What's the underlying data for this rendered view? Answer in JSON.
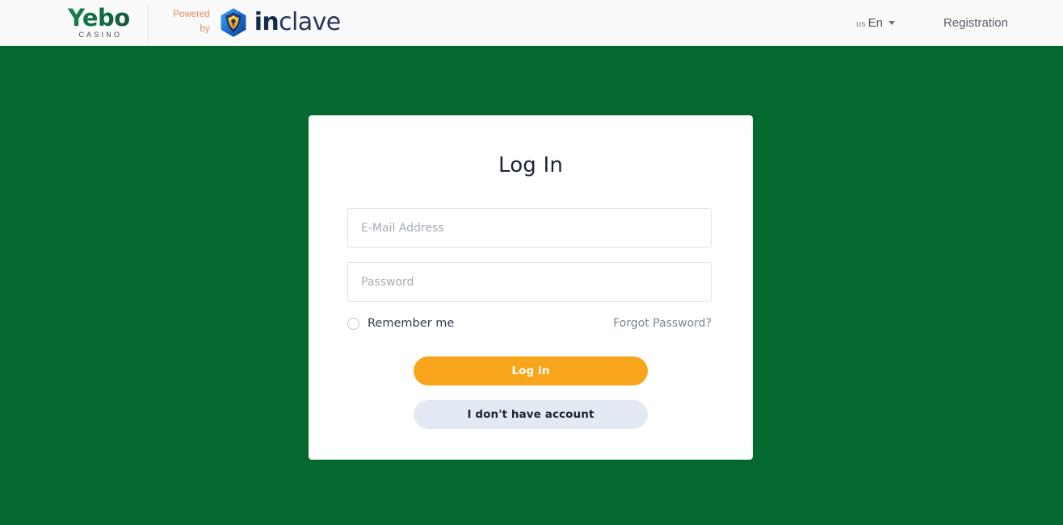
{
  "header": {
    "brand": {
      "name": "Yebo",
      "subtitle": "CASINO",
      "logo_color": "#15774A"
    },
    "powered": {
      "line1": "Powered",
      "line2": "by",
      "color": "#E48A62"
    },
    "partner": {
      "name_bold": "in",
      "name_light": "clave",
      "icon": "shield-hexagon-icon",
      "color": "#152B4E"
    },
    "language": {
      "flag_label": "us",
      "code": "En",
      "caret_icon": "chevron-down-icon"
    },
    "registration_label": "Registration",
    "background": "#FAFAFA"
  },
  "page": {
    "background": "#04682F"
  },
  "login": {
    "title": "Log In",
    "email": {
      "placeholder": "E-Mail Address",
      "value": ""
    },
    "password": {
      "placeholder": "Password",
      "value": ""
    },
    "remember": {
      "label": "Remember me",
      "checked": false
    },
    "forgot_password_label": "Forgot Password?",
    "primary_button": {
      "label": "Log in",
      "color": "#F9A51C",
      "text_color": "#FFFFFF"
    },
    "secondary_button": {
      "label": "I don't have account",
      "color": "#E4EAF3",
      "text_color": "#1C2438"
    }
  }
}
